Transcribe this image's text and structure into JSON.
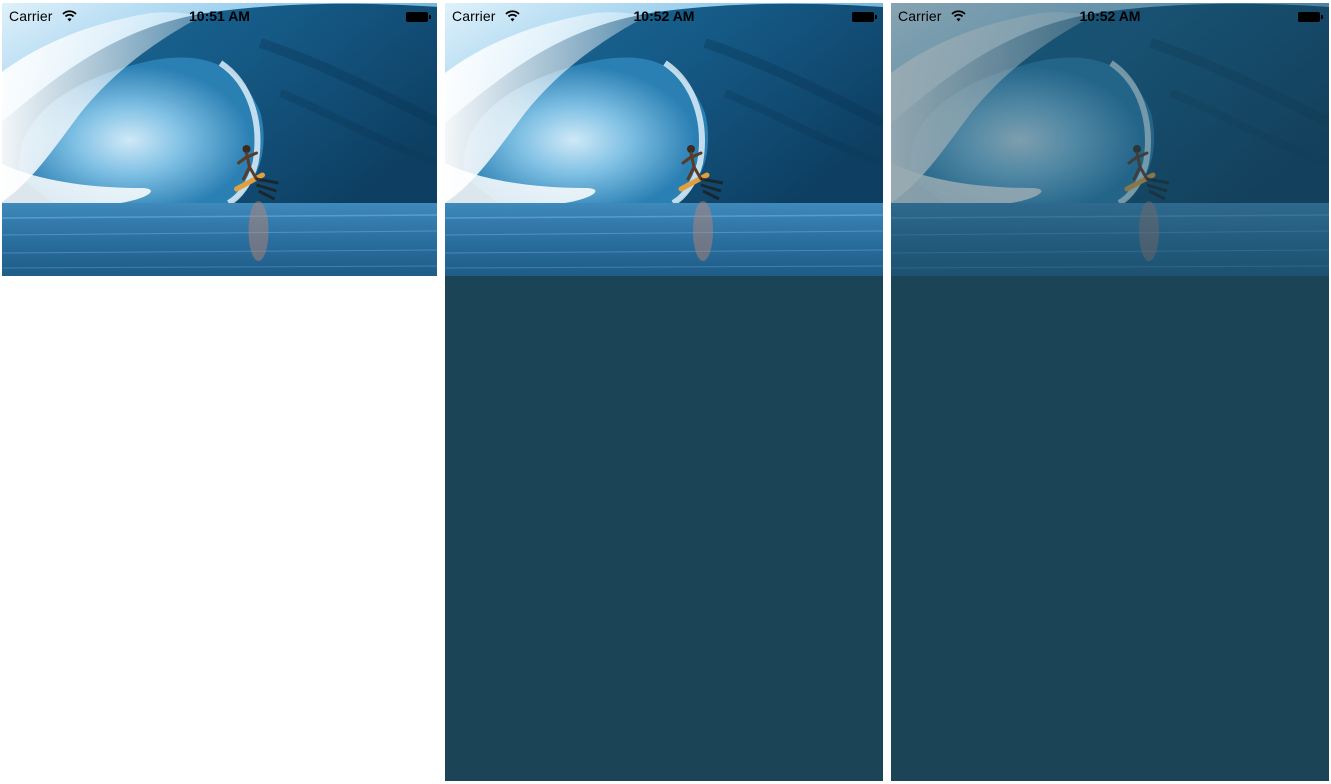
{
  "screens": [
    {
      "status_bar": {
        "carrier": "Carrier",
        "time": "10:51 AM"
      },
      "hero_image": "surfer-in-wave-barrel",
      "background_color": "#ffffff",
      "image_dim_opacity": 0
    },
    {
      "status_bar": {
        "carrier": "Carrier",
        "time": "10:52 AM"
      },
      "hero_image": "surfer-in-wave-barrel",
      "background_color": "#1b4457",
      "image_dim_opacity": 0
    },
    {
      "status_bar": {
        "carrier": "Carrier",
        "time": "10:52 AM"
      },
      "hero_image": "surfer-in-wave-barrel",
      "background_color": "#1b4457",
      "image_dim_opacity": 0.45
    }
  ],
  "icons": {
    "wifi": "wifi-icon",
    "battery": "battery-icon"
  }
}
